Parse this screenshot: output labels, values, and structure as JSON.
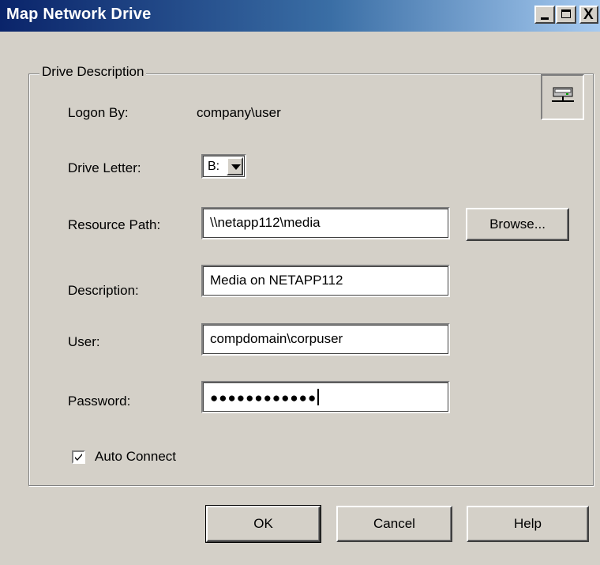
{
  "window": {
    "title": "Map Network Drive",
    "controls": {
      "minimize_icon": "minimize-icon",
      "maximize_icon": "maximize-icon",
      "close_icon": "close-icon",
      "close_glyph": "X"
    }
  },
  "group": {
    "label": "Drive Description",
    "network_icon": "network-drive-icon"
  },
  "form": {
    "logon_by_label": "Logon By:",
    "logon_by_value": "company\\user",
    "drive_letter_label": "Drive Letter:",
    "drive_letter_value": "B:",
    "resource_path_label": "Resource Path:",
    "resource_path_value": "\\\\netapp112\\media",
    "browse_label": "Browse...",
    "description_label": "Description:",
    "description_value": "Media on NETAPP112",
    "user_label": "User:",
    "user_value": "compdomain\\corpuser",
    "password_label": "Password:",
    "password_value": "●●●●●●●●●●●●",
    "auto_connect_label": "Auto Connect",
    "auto_connect_checked": true
  },
  "buttons": {
    "ok": "OK",
    "cancel": "Cancel",
    "help": "Help"
  },
  "colors": {
    "titlebar_start": "#0a246a",
    "titlebar_end": "#a6caf0",
    "face": "#d4d0c8"
  }
}
